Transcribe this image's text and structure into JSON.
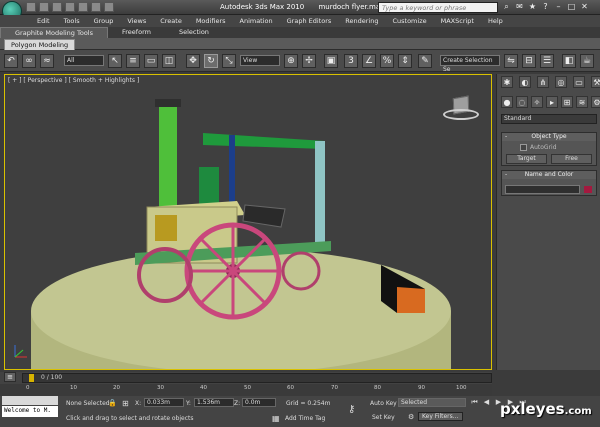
{
  "window": {
    "app_title": "Autodesk 3ds Max  2010",
    "file_name": "murdoch flyer.max",
    "search_placeholder": "Type a keyword or phrase"
  },
  "menu": [
    "Edit",
    "Tools",
    "Group",
    "Views",
    "Create",
    "Modifiers",
    "Animation",
    "Graph Editors",
    "Rendering",
    "Customize",
    "MAXScript",
    "Help"
  ],
  "ribbon": {
    "tabs": [
      "Graphite Modeling Tools",
      "Freeform",
      "Selection"
    ],
    "panel_button": "Polygon Modeling"
  },
  "toolbar": {
    "filter": "All",
    "ref_coord": "View",
    "named_selection": "Create Selection Se",
    "snap_label": "3"
  },
  "viewport": {
    "label": "[ + ] [ Perspective ] [ Smooth + Highlights ]"
  },
  "command_panel": {
    "category": "Standard",
    "object_type": "Object Type",
    "autogrid": "AutoGrid",
    "target_button": "Target",
    "free_button": "Free",
    "name_and_color": "Name and Color",
    "object_color": "#a4193f"
  },
  "timeline": {
    "frame_label": "0 / 100",
    "ruler_ticks": [
      "0",
      "10",
      "20",
      "30",
      "40",
      "50",
      "60",
      "70",
      "80",
      "90",
      "100"
    ]
  },
  "status": {
    "listener_text": "Welcome to M.",
    "selection": "None Selected",
    "prompt": "Click and drag to select and rotate objects",
    "x_label": "X:",
    "x_value": "0.033m",
    "y_label": "Y:",
    "y_value": "1.536m",
    "z_label": "Z:",
    "z_value": "0.0m",
    "grid": "Grid = 0.254m",
    "add_time_tag": "Add Time Tag",
    "auto_key": "Auto Key",
    "set_key": "Set Key",
    "key_mode": "Selected",
    "key_filters": "Key Filters..."
  },
  "watermark": {
    "text": "pxleyes",
    "suffix": ".com"
  }
}
